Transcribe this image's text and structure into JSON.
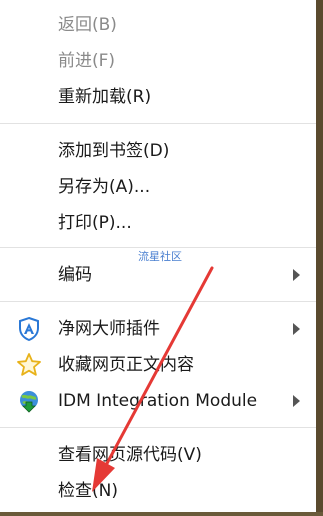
{
  "menu": {
    "back": "返回(B)",
    "forward": "前进(F)",
    "reload": "重新加载(R)",
    "bookmark": "添加到书签(D)",
    "save_as": "另存为(A)...",
    "print": "打印(P)...",
    "encoding": "编码",
    "ext_jingwang": "净网大师插件",
    "ext_collect": "收藏网页正文内容",
    "ext_idm": "IDM Integration Module",
    "view_source": "查看网页源代码(V)",
    "inspect": "检查(N)"
  },
  "watermark": "流星社区",
  "colors": {
    "annotation_arrow": "#e53935",
    "disabled_text": "#8a8a8a",
    "text": "#1a1a1a"
  },
  "icons": {
    "jingwang": "shield-a-icon",
    "collect": "star-icon",
    "idm": "idm-globe-arrow-icon",
    "submenu": "chevron-right-icon"
  }
}
